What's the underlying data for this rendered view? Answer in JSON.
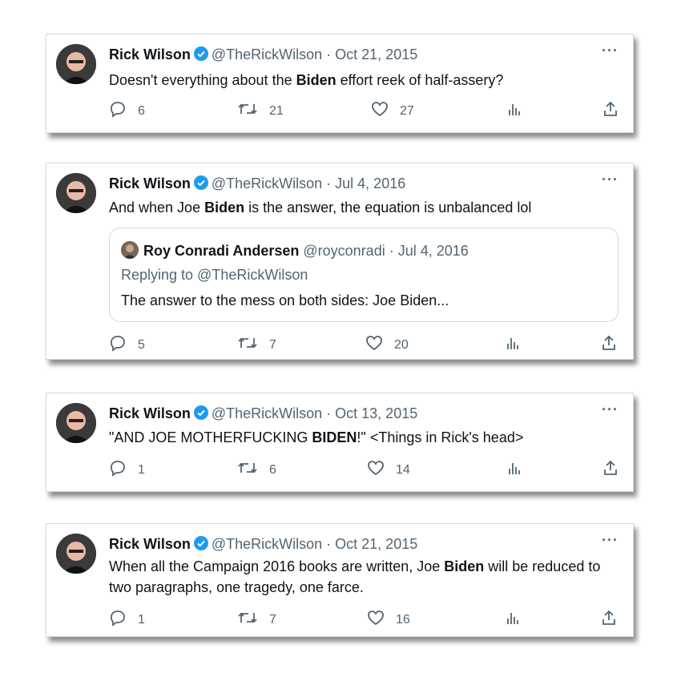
{
  "tweets": [
    {
      "name": "Rick Wilson",
      "handle": "@TheRickWilson",
      "date": "Oct 21, 2015",
      "text_pre": "Doesn't everything about the ",
      "text_bold": "Biden",
      "text_post": " effort reek of half-assery?",
      "replies": "6",
      "retweets": "21",
      "likes": "27"
    },
    {
      "name": "Rick Wilson",
      "handle": "@TheRickWilson",
      "date": "Jul 4, 2016",
      "text_pre": "And when Joe ",
      "text_bold": "Biden",
      "text_post": " is the answer, the equation is unbalanced lol",
      "quote": {
        "name": "Roy Conradi Andersen",
        "handle": "@royconradi",
        "date": "Jul 4, 2016",
        "replying": "Replying to @TheRickWilson",
        "text": "The answer to the mess on both sides: Joe Biden..."
      },
      "replies": "5",
      "retweets": "7",
      "likes": "20"
    },
    {
      "name": "Rick Wilson",
      "handle": "@TheRickWilson",
      "date": "Oct 13, 2015",
      "text_pre": "\"AND JOE MOTHERFUCKING ",
      "text_bold": "BIDEN",
      "text_post": "!\" <Things in Rick's head>",
      "replies": "1",
      "retweets": "6",
      "likes": "14"
    },
    {
      "name": "Rick Wilson",
      "handle": "@TheRickWilson",
      "date": "Oct 21, 2015",
      "text_pre": "When all the Campaign 2016 books are written, Joe ",
      "text_bold": "Biden",
      "text_post": " will be reduced to two paragraphs, one tragedy, one farce.",
      "replies": "1",
      "retweets": "7",
      "likes": "16"
    }
  ],
  "ui": {
    "separator": " · ",
    "more": "···"
  },
  "icons": [
    "reply-icon",
    "retweet-icon",
    "like-icon",
    "views-icon",
    "share-icon",
    "verified-badge-icon",
    "more-icon"
  ],
  "colors": {
    "verified": "#1d9bf0",
    "muted": "#536471",
    "text": "#0f1419"
  }
}
